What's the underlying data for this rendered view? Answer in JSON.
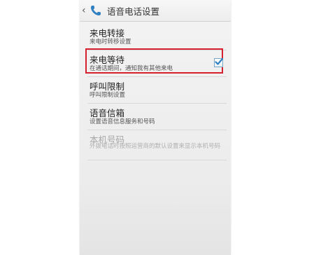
{
  "header": {
    "title": "语音电话设置",
    "back_glyph": "‹"
  },
  "settings": [
    {
      "label": "来电转接",
      "sub": "来电时转移设置"
    },
    {
      "label": "来电等待",
      "sub": "在通话期间，通知我有其他来电",
      "checked": true
    },
    {
      "label": "呼叫限制",
      "sub": "呼叫限制设置"
    },
    {
      "label": "语音信箱",
      "sub": "设置语音信息服务和号码"
    },
    {
      "label": "本机号码",
      "sub": "外拨电话时按照运营商的默认设置来显示本机号码",
      "disabled": true
    }
  ],
  "colors": {
    "highlight": "#d62030",
    "accent": "#2f7fc1"
  }
}
